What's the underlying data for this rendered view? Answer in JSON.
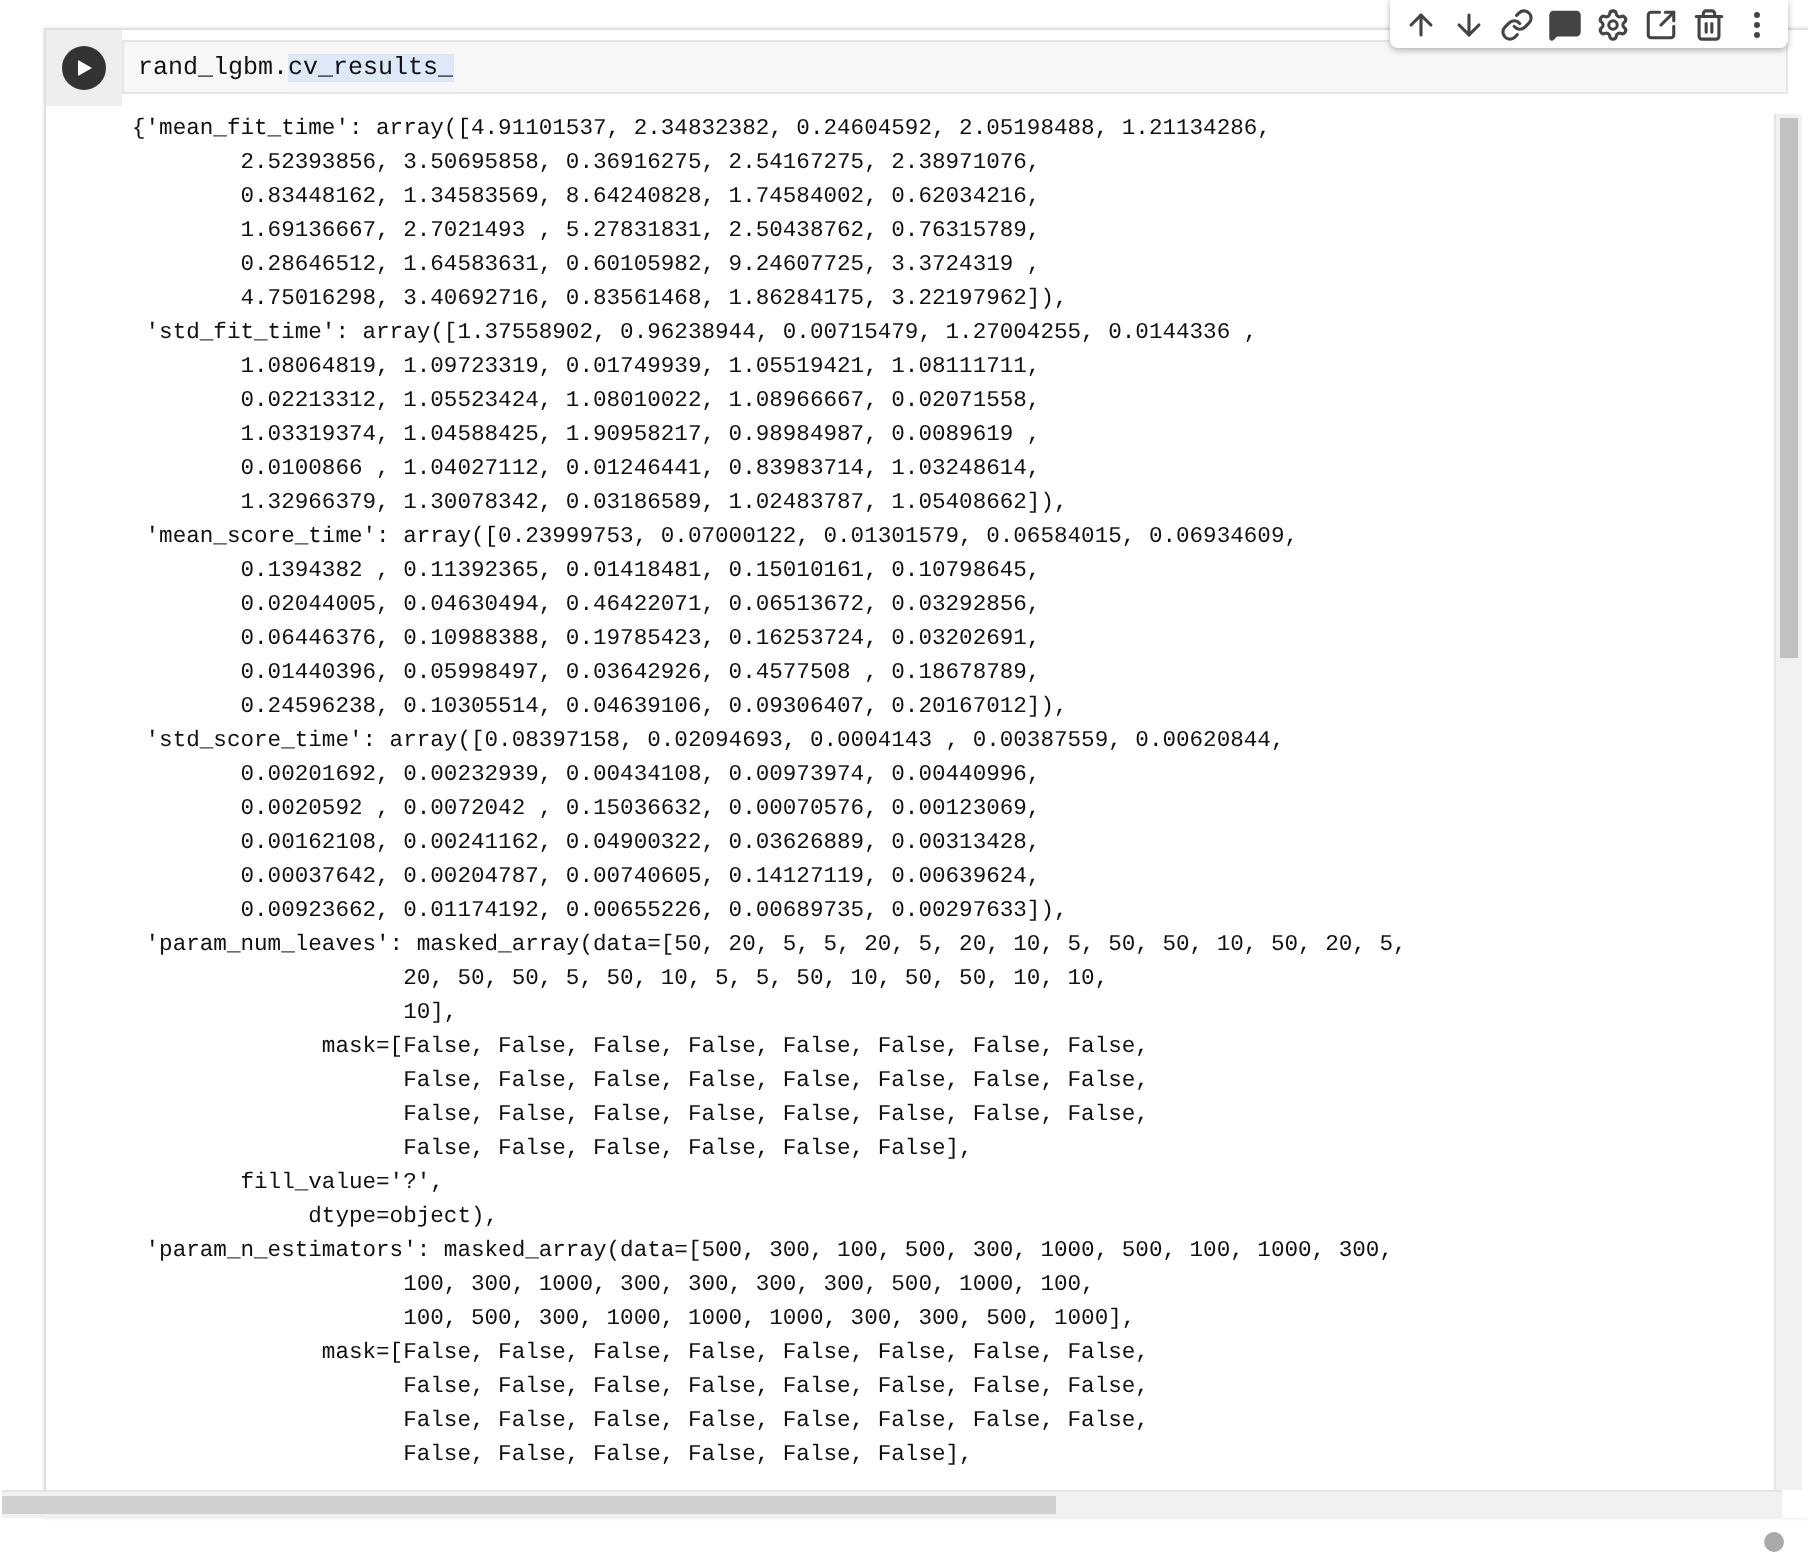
{
  "code_cell": {
    "code": [
      {
        "text": "rand_lgbm.",
        "highlighted": false
      },
      {
        "text": "cv_results_",
        "highlighted": true
      }
    ]
  },
  "output": {
    "lines": [
      "{'mean_fit_time': array([4.91101537, 2.34832382, 0.24604592, 2.05198488, 1.21134286,",
      "        2.52393856, 3.50695858, 0.36916275, 2.54167275, 2.38971076,",
      "        0.83448162, 1.34583569, 8.64240828, 1.74584002, 0.62034216,",
      "        1.69136667, 2.7021493 , 5.27831831, 2.50438762, 0.76315789,",
      "        0.28646512, 1.64583631, 0.60105982, 9.24607725, 3.3724319 ,",
      "        4.75016298, 3.40692716, 0.83561468, 1.86284175, 3.22197962]),",
      " 'std_fit_time': array([1.37558902, 0.96238944, 0.00715479, 1.27004255, 0.0144336 ,",
      "        1.08064819, 1.09723319, 0.01749939, 1.05519421, 1.08111711,",
      "        0.02213312, 1.05523424, 1.08010022, 1.08966667, 0.02071558,",
      "        1.03319374, 1.04588425, 1.90958217, 0.98984987, 0.0089619 ,",
      "        0.0100866 , 1.04027112, 0.01246441, 0.83983714, 1.03248614,",
      "        1.32966379, 1.30078342, 0.03186589, 1.02483787, 1.05408662]),",
      " 'mean_score_time': array([0.23999753, 0.07000122, 0.01301579, 0.06584015, 0.06934609,",
      "        0.1394382 , 0.11392365, 0.01418481, 0.15010161, 0.10798645,",
      "        0.02044005, 0.04630494, 0.46422071, 0.06513672, 0.03292856,",
      "        0.06446376, 0.10988388, 0.19785423, 0.16253724, 0.03202691,",
      "        0.01440396, 0.05998497, 0.03642926, 0.4577508 , 0.18678789,",
      "        0.24596238, 0.10305514, 0.04639106, 0.09306407, 0.20167012]),",
      " 'std_score_time': array([0.08397158, 0.02094693, 0.0004143 , 0.00387559, 0.00620844,",
      "        0.00201692, 0.00232939, 0.00434108, 0.00973974, 0.00440996,",
      "        0.0020592 , 0.0072042 , 0.15036632, 0.00070576, 0.00123069,",
      "        0.00162108, 0.00241162, 0.04900322, 0.03626889, 0.00313428,",
      "        0.00037642, 0.00204787, 0.00740605, 0.14127119, 0.00639624,",
      "        0.00923662, 0.01174192, 0.00655226, 0.00689735, 0.00297633]),",
      " 'param_num_leaves': masked_array(data=[50, 20, 5, 5, 20, 5, 20, 10, 5, 50, 50, 10, 50, 20, 5,",
      "                    20, 50, 50, 5, 50, 10, 5, 5, 50, 10, 50, 50, 10, 10,",
      "                    10],",
      "              mask=[False, False, False, False, False, False, False, False,",
      "                    False, False, False, False, False, False, False, False,",
      "                    False, False, False, False, False, False, False, False,",
      "                    False, False, False, False, False, False],",
      "        fill_value='?',",
      "             dtype=object),",
      " 'param_n_estimators': masked_array(data=[500, 300, 100, 500, 300, 1000, 500, 100, 1000, 300,",
      "                    100, 300, 1000, 300, 300, 300, 300, 500, 1000, 100,",
      "                    100, 500, 300, 1000, 1000, 1000, 300, 300, 500, 1000],",
      "              mask=[False, False, False, False, False, False, False, False,",
      "                    False, False, False, False, False, False, False, False,",
      "                    False, False, False, False, False, False, False, False,",
      "                    False, False, False, False, False, False],"
    ]
  }
}
